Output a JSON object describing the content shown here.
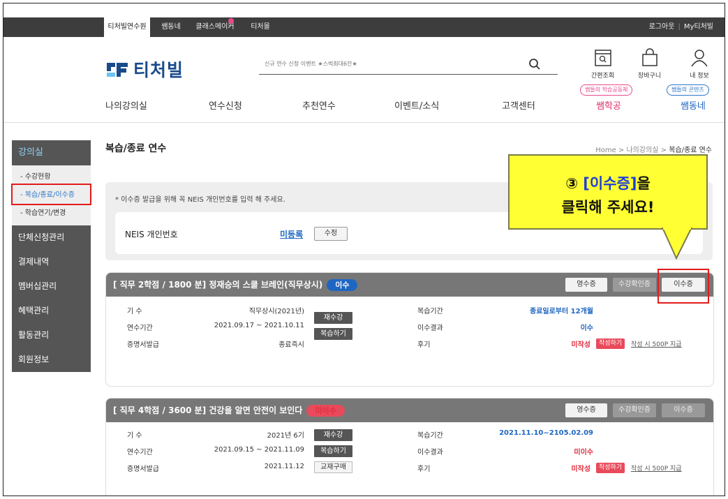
{
  "topbar": {
    "tabs": [
      "티처빌연수원",
      "쌤동네",
      "클래스메이커",
      "티처몰"
    ],
    "logout": "로그아웃",
    "my": "My티처빌"
  },
  "header": {
    "logo_text": "티처빌",
    "search_placeholder": "신규 연수 신청 이벤트 ★스벅최대6잔★",
    "icons": [
      {
        "label": "간편조회",
        "icon": "search-box-icon"
      },
      {
        "label": "장바구니",
        "icon": "shopping-bag-icon"
      },
      {
        "label": "내 정보",
        "icon": "user-icon"
      }
    ],
    "pill_pink": "쌤들의 학습공동체",
    "pill_blue": "쌤들의 콘텐츠"
  },
  "gnb": [
    "나의강의실",
    "연수신청",
    "추천연수",
    "이벤트/소식",
    "고객센터",
    "쌤학공",
    "쌤동네"
  ],
  "sidebar": {
    "head": "강의실",
    "sub": [
      "- 수강현황",
      "- 복습/종료/이수증",
      "- 학습연기/변경"
    ],
    "menu": [
      "단체신청관리",
      "결제내역",
      "멤버십관리",
      "혜택관리",
      "활동관리",
      "회원정보"
    ]
  },
  "page": {
    "title": "복습/종료 연수",
    "breadcrumb": {
      "home": "Home",
      "sep": ">",
      "mid": "나의강의실",
      "current": "복습/종료 연수"
    }
  },
  "notice": {
    "message": "* 이수증 발급을 위해 꼭 NEIS 개인번호를 입력 해 주세요.",
    "label": "NEIS 개인번호",
    "value": "미등록",
    "edit": "수정"
  },
  "callout": {
    "num": "③",
    "highlight": "[이수증]",
    "line1_rest": "을",
    "line2": "클릭해 주세요!"
  },
  "courses": [
    {
      "title": "[ 직무 2학점 / 1800 분] 정재승의 스쿨 브레인(직무상시)",
      "status": "이수",
      "buttons": [
        "영수증",
        "수강확인증",
        "이수증"
      ],
      "labels": [
        "기  수",
        "연수기간",
        "증명서발급"
      ],
      "values": [
        "직무상시(2021년)",
        "2021.09.17 ~ 2021.10.11",
        "종료즉시"
      ],
      "actions": [
        "재수강",
        "복습하기"
      ],
      "right_labels": [
        "복습기간",
        "이수결과",
        "후기"
      ],
      "review_period": "종료일로부터 12개월",
      "result": "이수",
      "review_status": "미작성",
      "write": "작성하기",
      "reward": "작성 시 500P 지급"
    },
    {
      "title": "[ 직무 4학점 / 3600 분] 건강을 알면 안전이 보인다",
      "status": "미이수",
      "buttons": [
        "영수증",
        "수강확인증",
        "이수증"
      ],
      "labels": [
        "기  수",
        "연수기간",
        "증명서발급"
      ],
      "values": [
        "2021년 6기",
        "2021.09.15 ~ 2021.11.09",
        "2021.11.12"
      ],
      "actions": [
        "재수강",
        "복습하기",
        "교재구매"
      ],
      "right_labels": [
        "복습기간",
        "이수결과",
        "후기"
      ],
      "review_period": "2021.11.10~2105.02.09",
      "result": "미이수",
      "review_status": "미작성",
      "write": "작성하기",
      "reward": "작성 시 500P 지급"
    }
  ]
}
